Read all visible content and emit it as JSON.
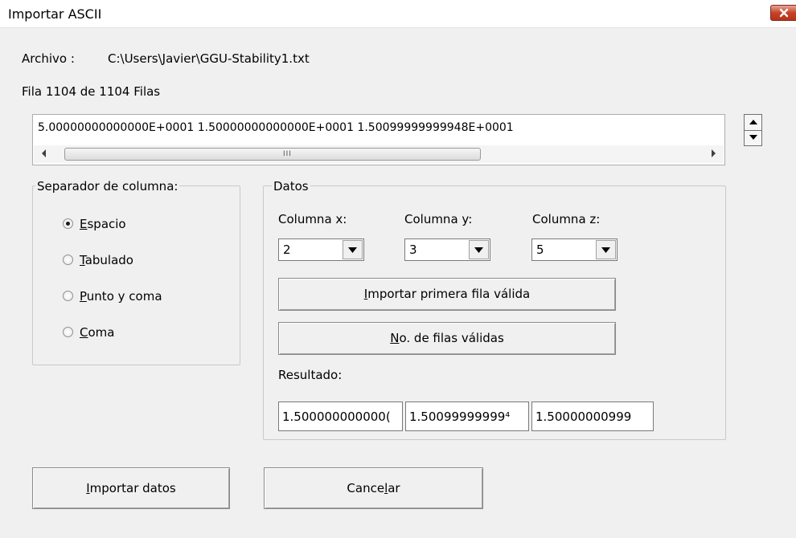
{
  "window": {
    "title": "Importar ASCII"
  },
  "file": {
    "label": "Archivo :",
    "path": "C:\\Users\\Javier\\GGU-Stability1.txt"
  },
  "row_info": "Fila  1104 de 1104 Filas",
  "preview": {
    "line": "5.00000000000000E+0001  1.50000000000000E+0001  1.50099999999948E+0001"
  },
  "separator": {
    "title": "Separador de columna:",
    "options": [
      {
        "mnemonic": "E",
        "rest": "spacio",
        "checked": true
      },
      {
        "mnemonic": "T",
        "rest": "abulado",
        "checked": false
      },
      {
        "mnemonic": "P",
        "rest": "unto y coma",
        "checked": false
      },
      {
        "mnemonic": "C",
        "rest": "oma",
        "checked": false
      }
    ]
  },
  "data_group": {
    "title": "Datos",
    "col_x_label": "Columna x:",
    "col_y_label": "Columna y:",
    "col_z_label": "Columna z:",
    "col_x_value": "2",
    "col_y_value": "3",
    "col_z_value": "5",
    "import_first_row": {
      "mnemonic": "I",
      "rest": "mportar primera fila válida"
    },
    "valid_rows": {
      "mnemonic": "N",
      "rest": "o. de filas válidas"
    },
    "result_label": "Resultado:",
    "results": [
      "1.500000000000(",
      "1.50099999999⁴",
      "1.50000000999"
    ]
  },
  "buttons": {
    "import": {
      "mnemonic": "I",
      "rest": "mportar datos"
    },
    "cancel": {
      "before": "Cance",
      "mnemonic": "l",
      "after": "ar"
    }
  },
  "colors": {
    "close_button": "#c5432a",
    "background": "#f0f0f0"
  }
}
